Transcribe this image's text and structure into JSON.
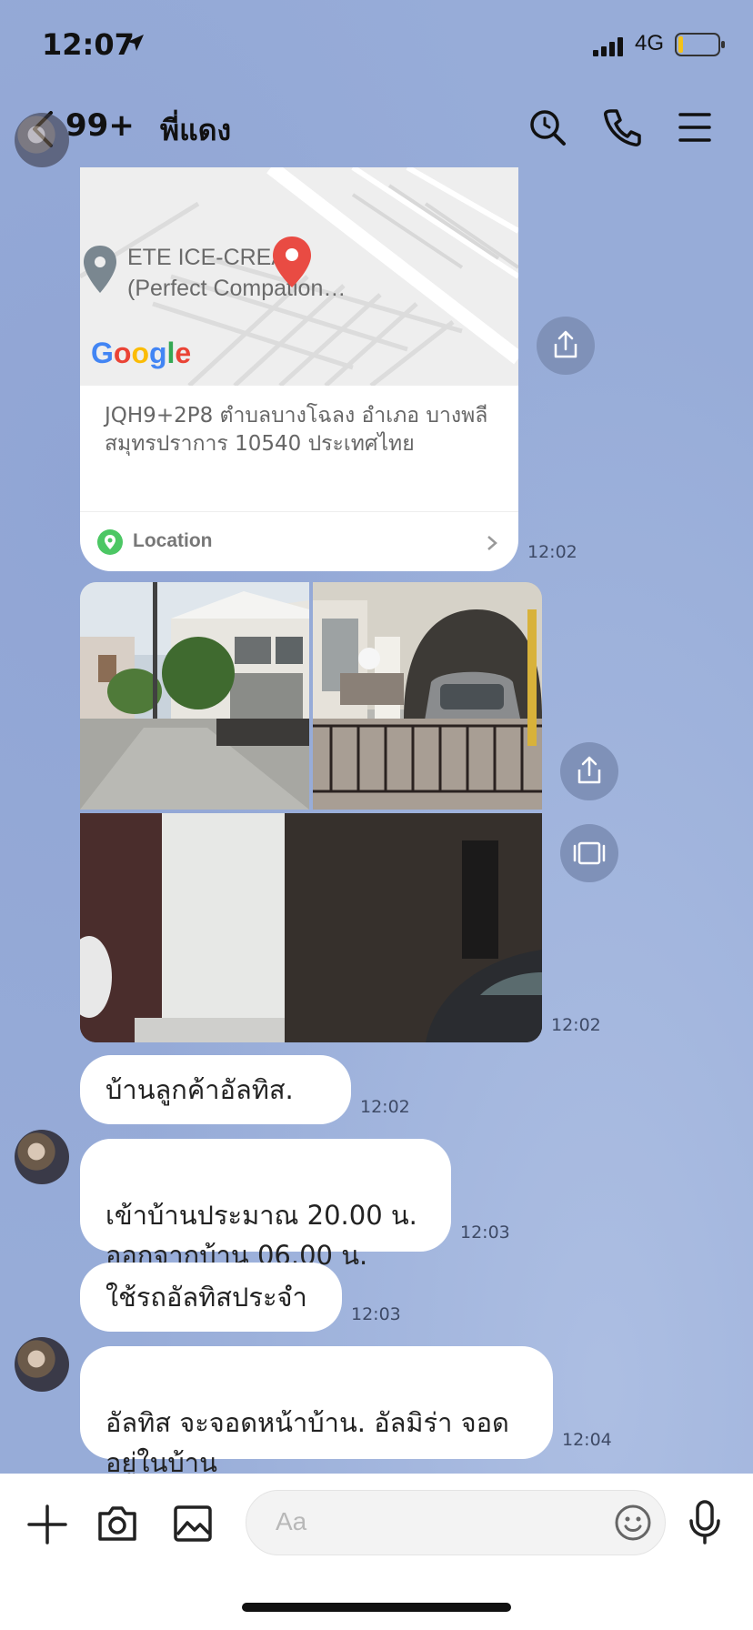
{
  "status": {
    "time": "12:07",
    "network": "4G"
  },
  "header": {
    "unread_count": "99+",
    "chat_name": "พี่แดง"
  },
  "location_card": {
    "map_place": "ETE ICE-CREAM\n(Perfect Compation…",
    "map_brand": "Google",
    "address": "JQH9+2P8 ตำบลบางโฉลง อำเภอ บางพลี สมุทรปราการ 10540 ประเทศไทย",
    "footer_label": "Location",
    "time": "12:02"
  },
  "photos": {
    "time": "12:02"
  },
  "messages": [
    {
      "text": "บ้านลูกค้าอัลทิส.",
      "time": "12:02"
    },
    {
      "text": "เข้าบ้านประมาณ 20.00 น.\nออกจากบ้าน 06.00 น.",
      "time": "12:03"
    },
    {
      "text": "ใช้รถอัลทิสประจำ",
      "time": "12:03"
    },
    {
      "text": "อัลทิส จะจอดหน้าบ้าน.  อัลมิร่า จอด\nอยู่ในบ้าน",
      "time": "12:04"
    }
  ],
  "composer": {
    "placeholder": "Aa"
  },
  "colors": {
    "background": "#97acd8",
    "bubble": "#ffffff",
    "map_pin": "#e94b43",
    "location_icon": "#4cc764"
  },
  "icons": [
    "back-icon",
    "search-icon",
    "phone-icon",
    "menu-icon",
    "share-icon",
    "album-icon",
    "plus-icon",
    "camera-icon",
    "image-icon",
    "emoji-icon",
    "mic-icon"
  ]
}
